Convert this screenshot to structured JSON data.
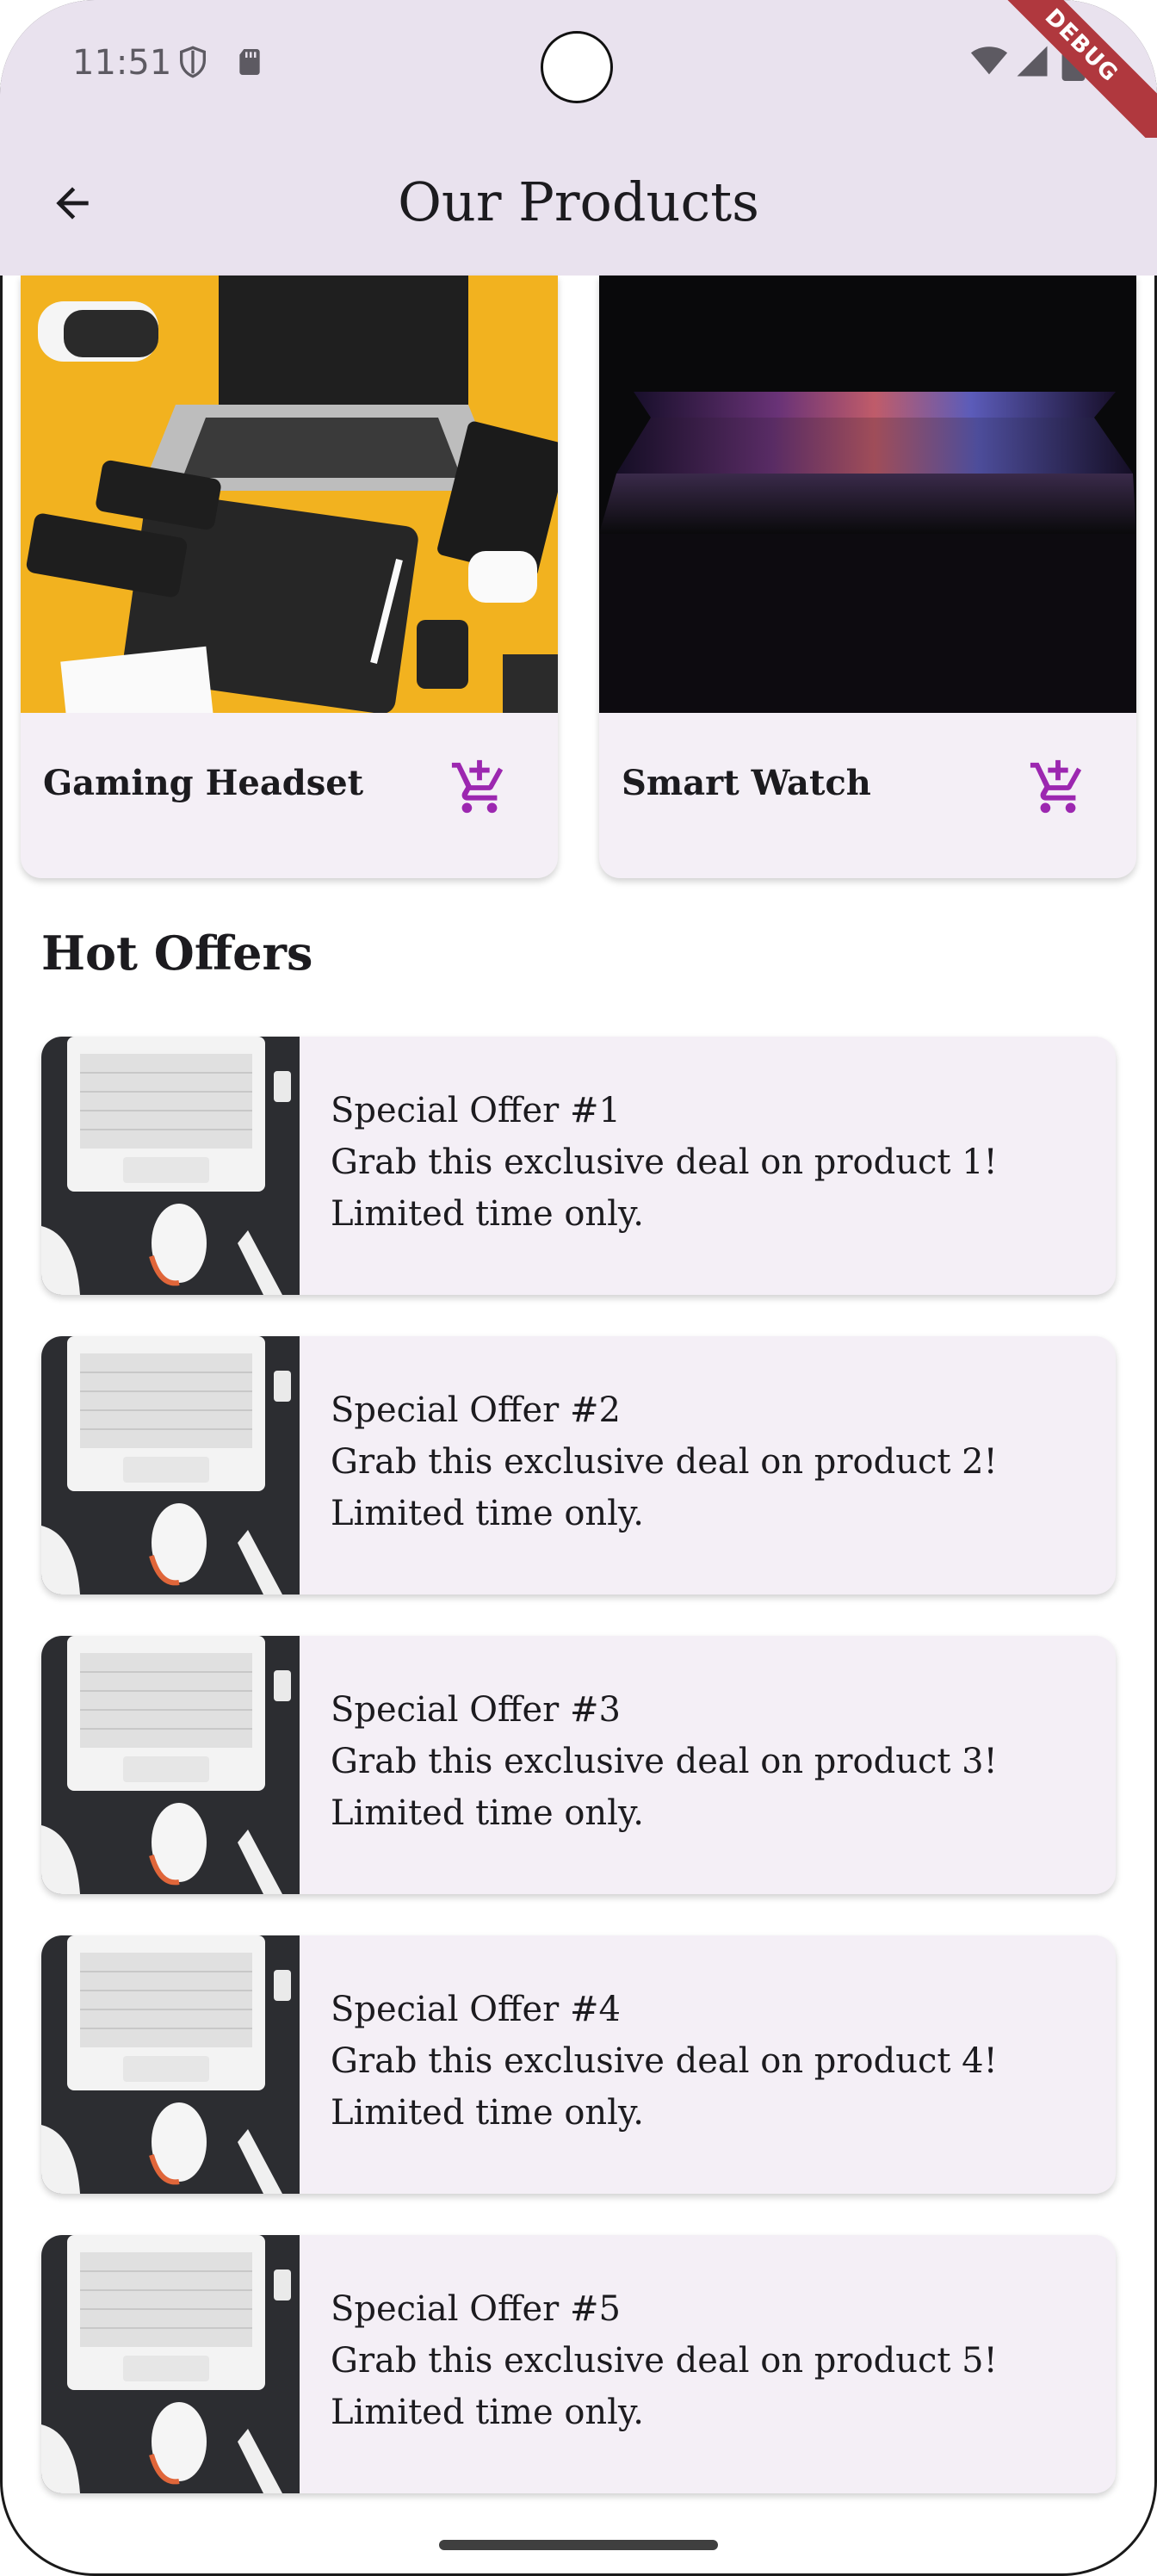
{
  "status_bar": {
    "time": "11:51"
  },
  "debug_badge": "DEBUG",
  "app_bar": {
    "title": "Our Products"
  },
  "products": [
    {
      "name": "Gaming Headset",
      "cart_icon": "add-shopping-cart-icon"
    },
    {
      "name": "Smart Watch",
      "cart_icon": "add-shopping-cart-icon"
    }
  ],
  "hot_offers": {
    "title": "Hot Offers",
    "items": [
      {
        "title": "Special Offer #1",
        "line1": "Grab this exclusive deal on product 1!",
        "line2": "Limited time only."
      },
      {
        "title": "Special Offer #2",
        "line1": "Grab this exclusive deal on product 2!",
        "line2": "Limited time only."
      },
      {
        "title": "Special Offer #3",
        "line1": "Grab this exclusive deal on product 3!",
        "line2": "Limited time only."
      },
      {
        "title": "Special Offer #4",
        "line1": "Grab this exclusive deal on product 4!",
        "line2": "Limited time only."
      },
      {
        "title": "Special Offer #5",
        "line1": "Grab this exclusive deal on product 5!",
        "line2": "Limited time only."
      }
    ]
  },
  "colors": {
    "accent": "#9c27b0",
    "app_bar_bg": "#e9e2ee",
    "card_bg": "#f4eff6"
  }
}
